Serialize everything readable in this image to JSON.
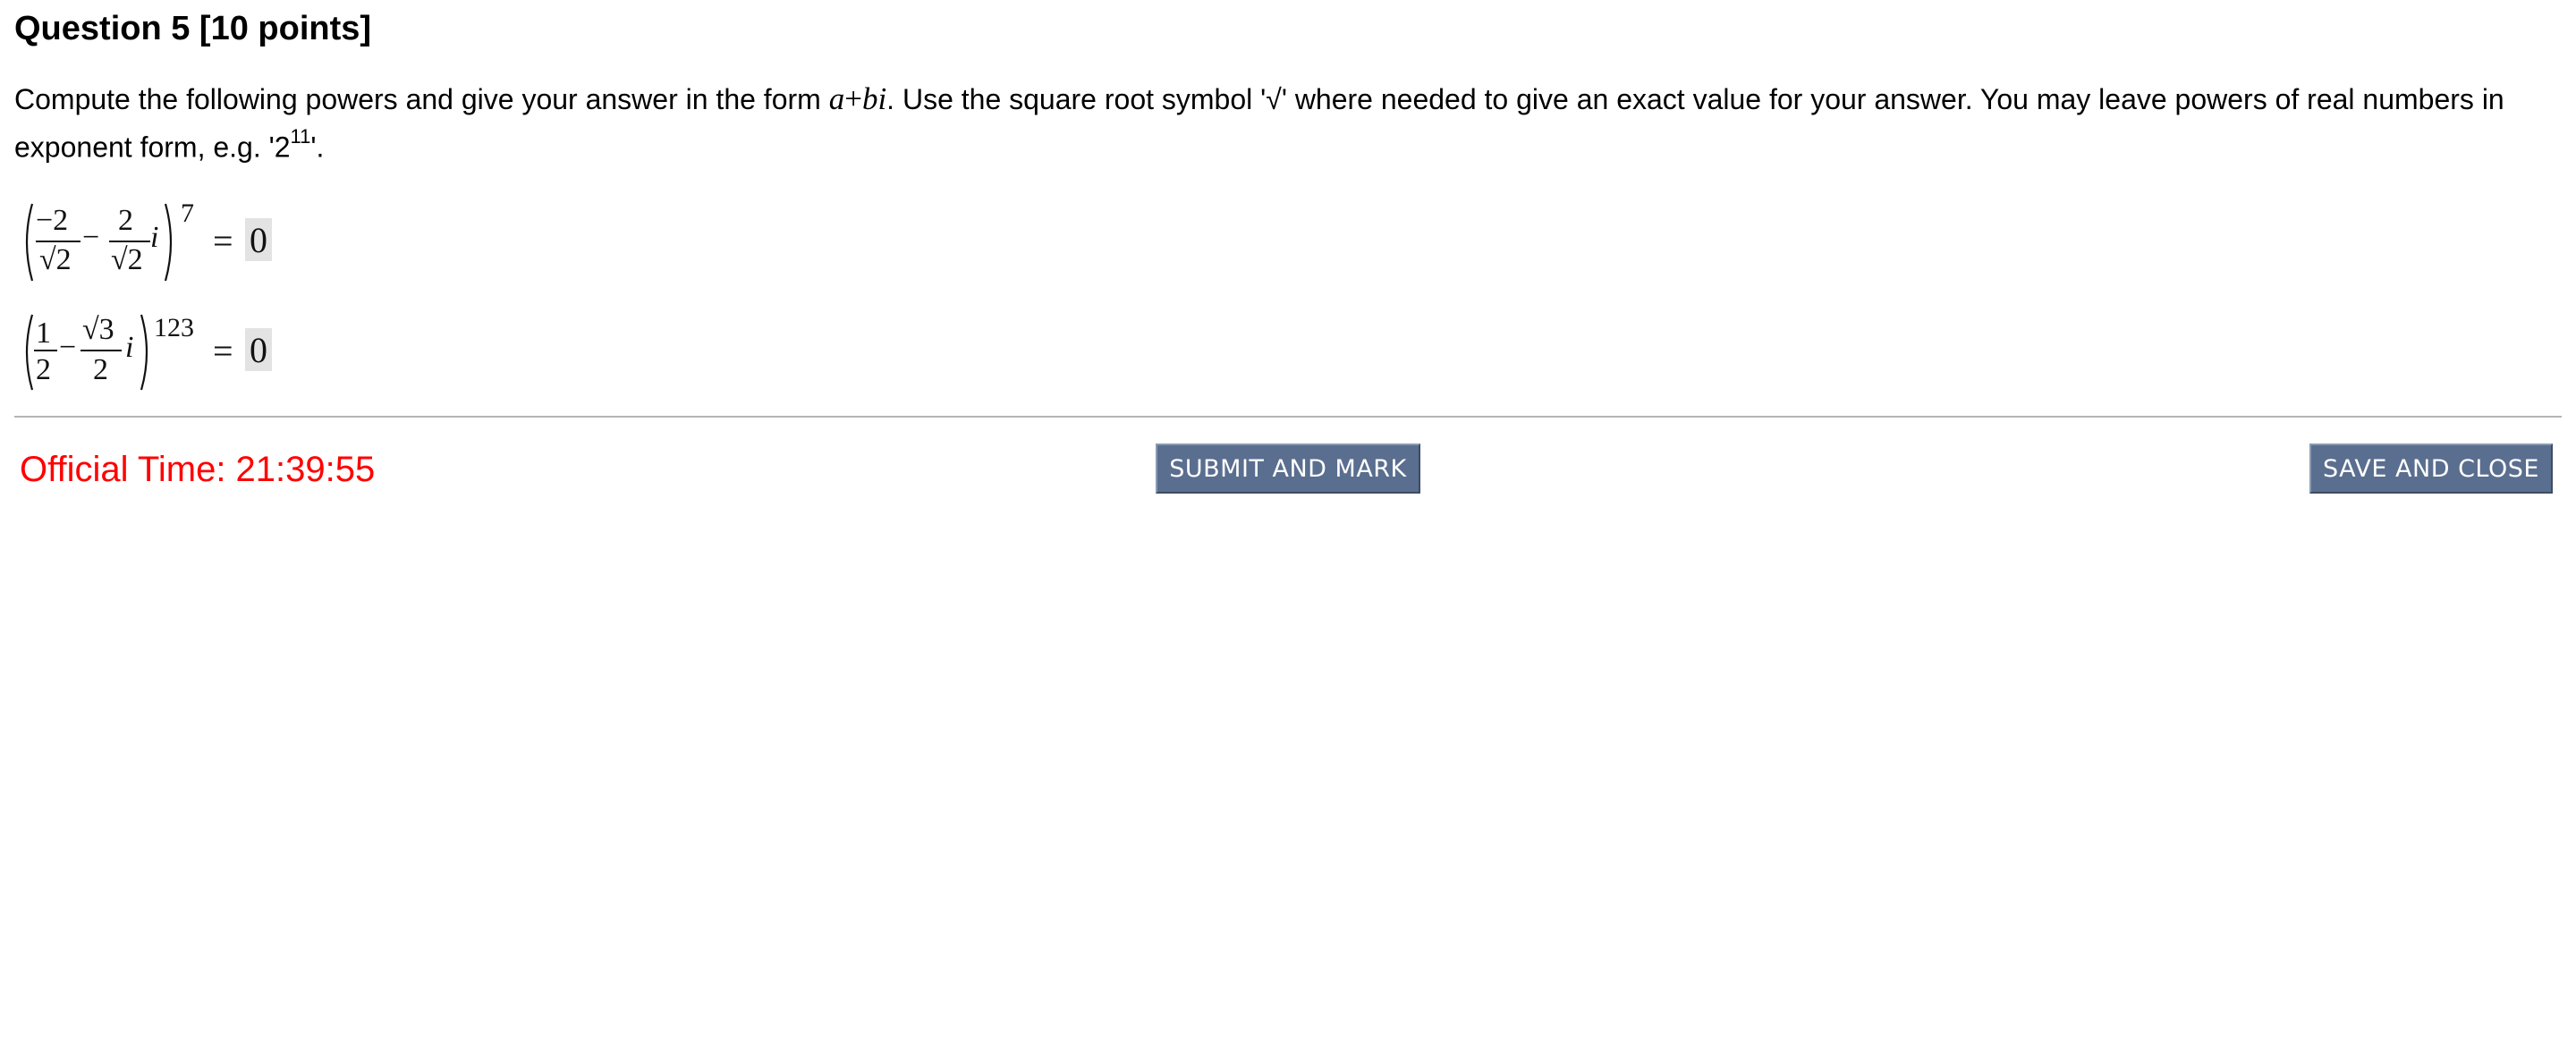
{
  "question": {
    "title": "Question 5 [10 points]",
    "instructions": {
      "part1": "Compute the following powers and give your answer in the form ",
      "form_a": "a",
      "form_plus": "+",
      "form_bi": "bi",
      "part2": ". Use the square root symbol '√' where needed to give an exact value for your answer. You may leave powers of real numbers in exponent form, e.g. '2",
      "example_exponent": "11",
      "part3": "'."
    }
  },
  "problems": [
    {
      "term1_numerator": "−2",
      "term1_denominator": "√2",
      "operator": "−",
      "term2_numerator": "2",
      "term2_denominator": "√2",
      "imag_unit": "i",
      "exponent": "7",
      "equals": "=",
      "answer_value": "0"
    },
    {
      "term1_numerator": "1",
      "term1_denominator": "2",
      "operator": "−",
      "term2_numerator": "√3",
      "term2_denominator": "2",
      "imag_unit": "i",
      "exponent": "123",
      "equals": "=",
      "answer_value": "0"
    }
  ],
  "footer": {
    "timer_label": "Official Time: 21:39:55",
    "submit_label": "SUBMIT AND MARK",
    "save_label": "SAVE AND CLOSE"
  },
  "colors": {
    "timer": "#ff0000",
    "button_bg": "#5a6e8f",
    "answer_box_bg": "#e3e3e3",
    "divider": "#b5b5b5"
  }
}
